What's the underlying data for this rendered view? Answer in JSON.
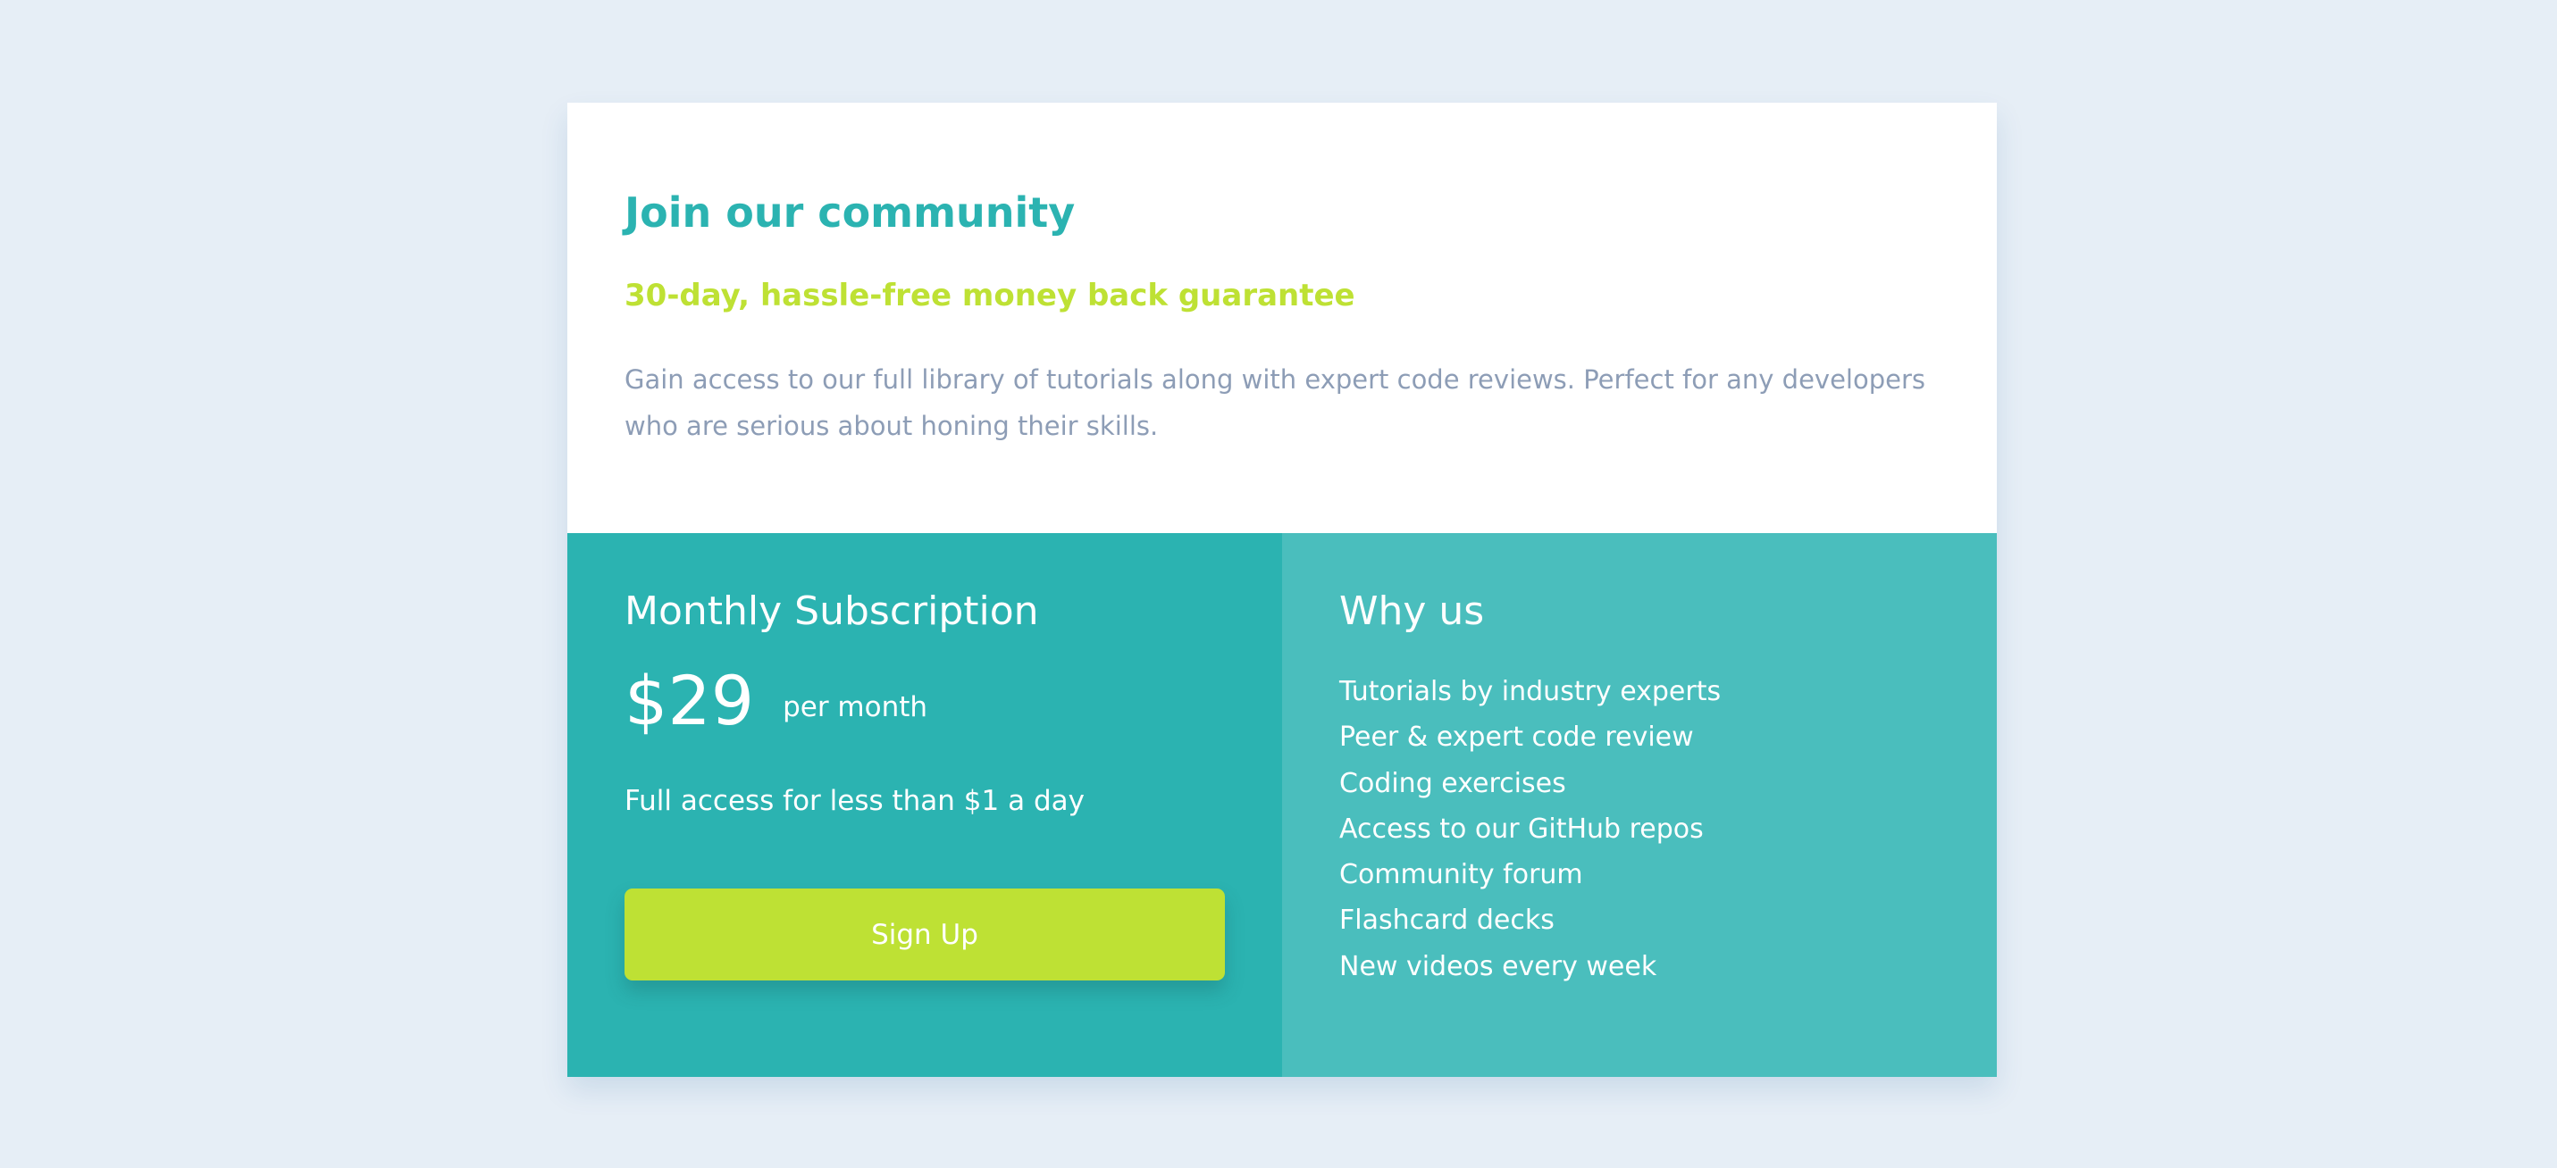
{
  "community": {
    "title": "Join our community",
    "subtitle": "30-day, hassle-free money back guarantee",
    "description": "Gain access to our full library of tutorials along with expert code reviews. Perfect for any developers who are serious about honing their skills."
  },
  "subscription": {
    "title": "Monthly Subscription",
    "price": "$29",
    "period": "per month",
    "note": "Full access for less than $1 a day",
    "button_label": "Sign Up"
  },
  "why_us": {
    "title": "Why us",
    "items": [
      "Tutorials by industry experts",
      "Peer & expert code review",
      "Coding exercises",
      "Access to our GitHub repos",
      "Community forum",
      "Flashcard decks",
      "New videos every week"
    ]
  },
  "colors": {
    "background": "#e6eef6",
    "primary_teal": "#2bb3b1",
    "light_teal": "#4abebd",
    "accent_lime": "#bee134",
    "muted_text": "#8d9db6"
  }
}
